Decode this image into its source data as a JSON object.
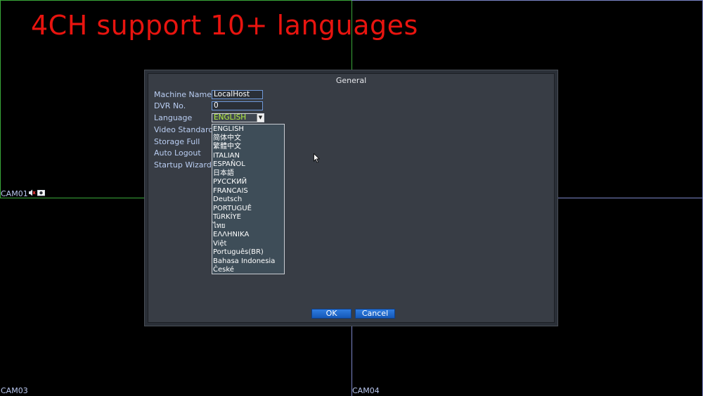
{
  "headline": "4CH support 10+ languages",
  "cameras": {
    "cam1": "CAM01",
    "cam3": "CAM03",
    "cam4": "CAM04",
    "cam1_icons": [
      "speaker-muted-icon",
      "record-icon"
    ]
  },
  "dialog": {
    "title": "General",
    "fields": {
      "machine_name_label": "Machine Name",
      "machine_name_value": "LocalHost",
      "dvr_no_label": "DVR No.",
      "dvr_no_value": "0",
      "language_label": "Language",
      "language_value": "ENGLISH",
      "video_standard_label": "Video Standard",
      "storage_full_label": "Storage Full",
      "auto_logout_label": "Auto Logout",
      "startup_wizard_label": "Startup Wizard"
    },
    "language_options": [
      "ENGLISH",
      "简体中文",
      "繁體中文",
      "ITALIAN",
      "ESPAÑOL",
      "日本語",
      "РУССКИЙ",
      "FRANCAIS",
      "Deutsch",
      "PORTUGUÊ",
      "TüRKİYE",
      "ไทย",
      "ΕΛΛΗΝΙΚΑ",
      "Việt",
      "Português(BR)",
      "Bahasa Indonesia",
      "České"
    ],
    "ok_label": "OK",
    "cancel_label": "Cancel"
  },
  "colors": {
    "headline": "#e8140f",
    "label": "#b9cdf2",
    "selected_language": "#b4f040",
    "button": "#1f6ad0",
    "grid_green": "#3aa83a",
    "grid_blue": "#7b86c8"
  }
}
